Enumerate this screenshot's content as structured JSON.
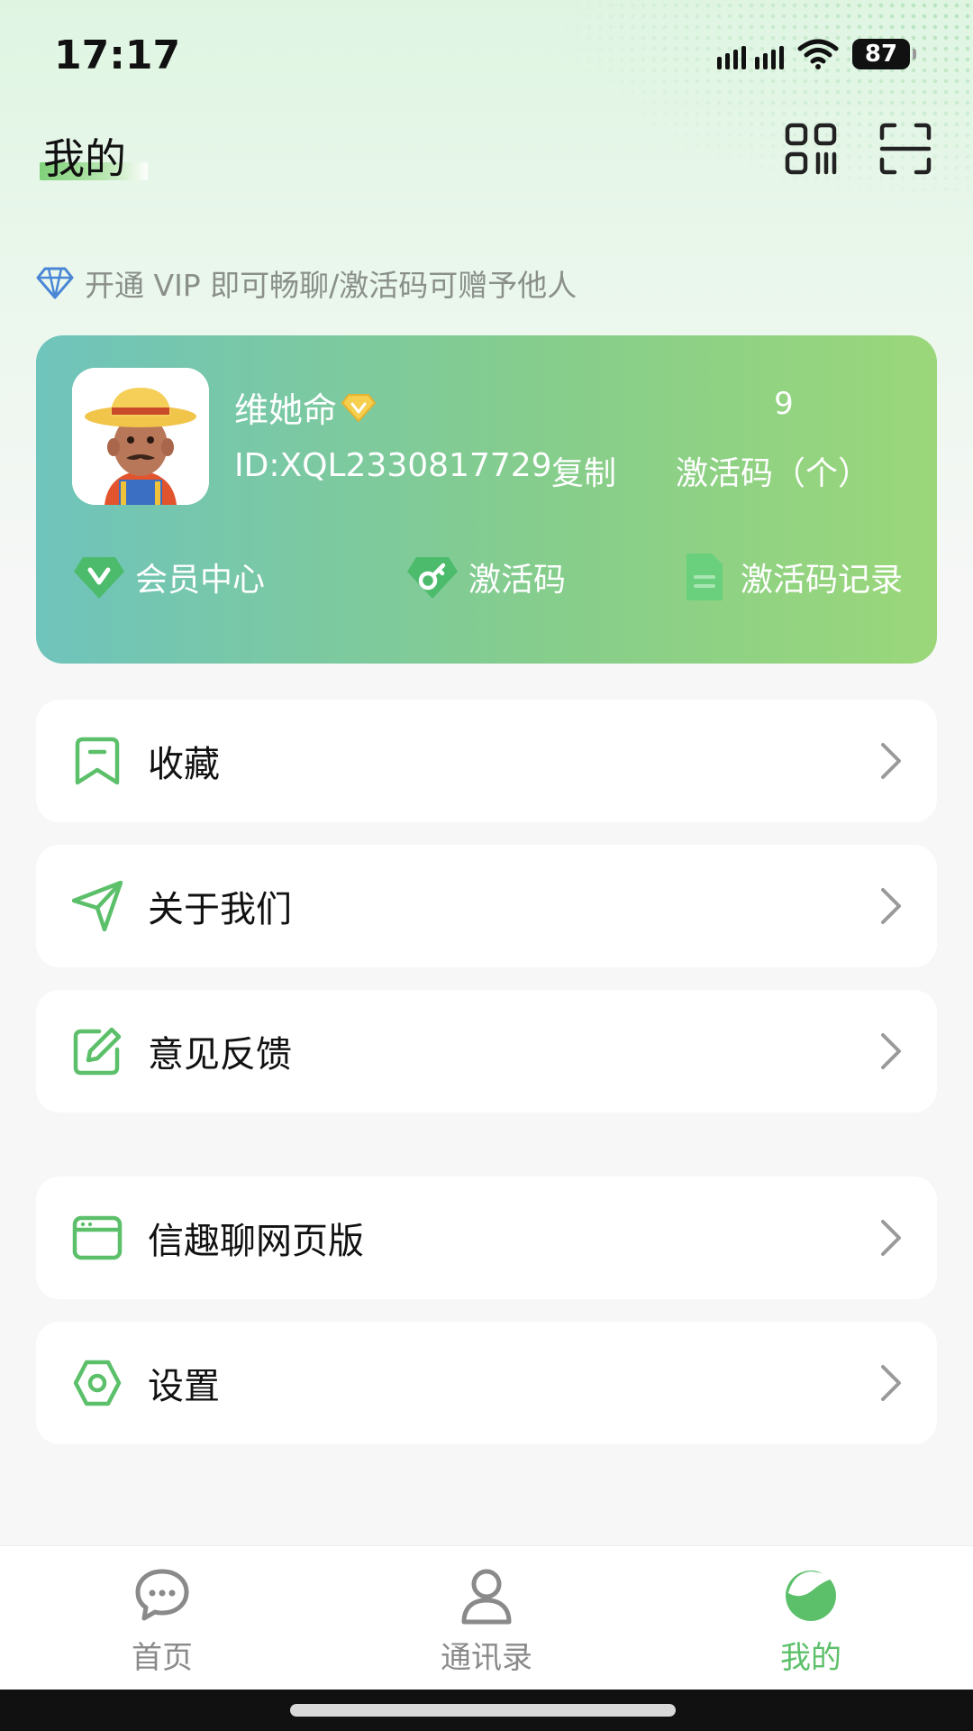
{
  "status_bar": {
    "time": "17:17",
    "battery": "87"
  },
  "header": {
    "title": "我的",
    "qr_icon": "qr-code-icon",
    "scan_icon": "scan-icon"
  },
  "vip_promo": {
    "text": "开通 VIP 即可畅聊/激活码可赠予他人",
    "icon": "diamond-icon"
  },
  "profile": {
    "name": "维她命",
    "id": "ID:XQL2330817729",
    "copy_label": "复制",
    "activation_count": "9",
    "activation_label": "激活码（个）",
    "actions": [
      {
        "label": "会员中心",
        "icon": "vip-badge-icon"
      },
      {
        "label": "激活码",
        "icon": "key-icon"
      },
      {
        "label": "激活码记录",
        "icon": "document-icon"
      }
    ]
  },
  "menu": [
    {
      "label": "收藏",
      "icon": "bookmark-icon"
    },
    {
      "label": "关于我们",
      "icon": "send-icon"
    },
    {
      "label": "意见反馈",
      "icon": "edit-icon"
    },
    {
      "label": "信趣聊网页版",
      "icon": "browser-icon"
    },
    {
      "label": "设置",
      "icon": "settings-icon"
    }
  ],
  "tabs": [
    {
      "label": "首页",
      "icon": "chat-bubble-icon",
      "active": false
    },
    {
      "label": "通讯录",
      "icon": "contacts-icon",
      "active": false
    },
    {
      "label": "我的",
      "icon": "profile-icon",
      "active": true
    }
  ],
  "colors": {
    "accent": "#5cc06a",
    "card_start": "#6fc4bc",
    "card_end": "#9bd77a",
    "muted_text": "#8a8f8a"
  }
}
